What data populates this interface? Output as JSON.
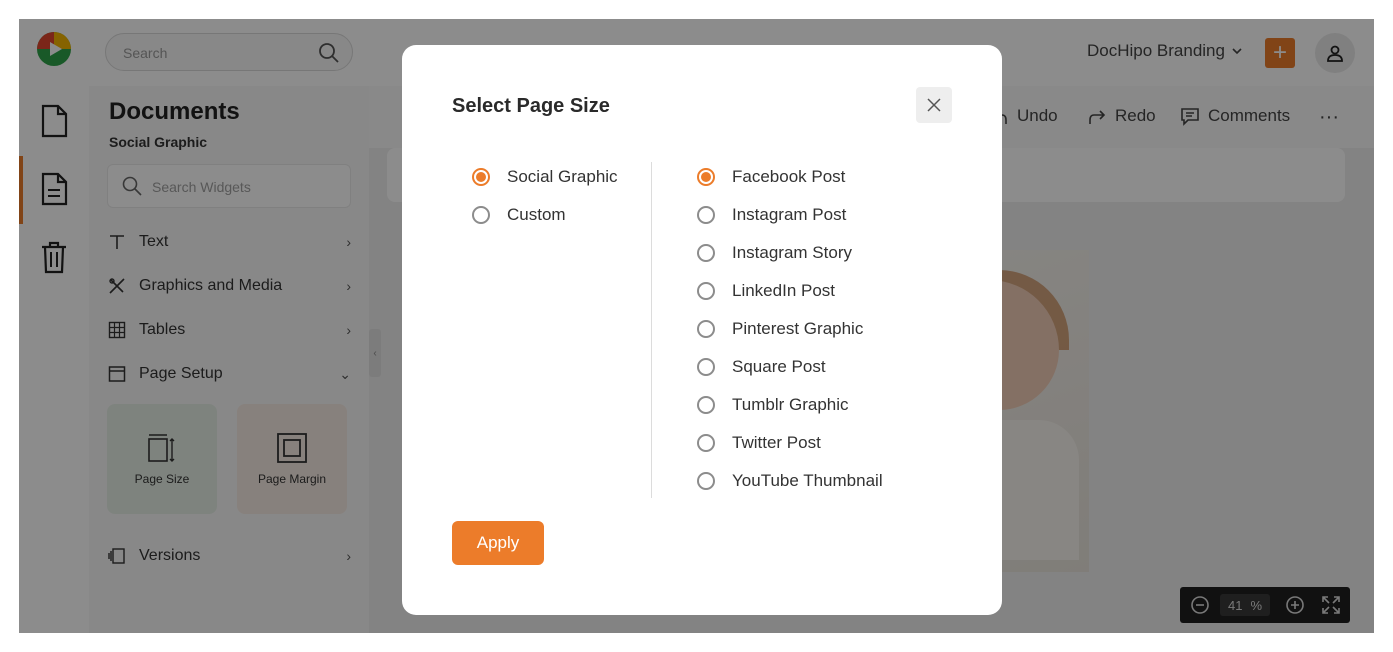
{
  "header": {
    "search_placeholder": "Search",
    "workspace_name": "DocHipo Branding",
    "create_label": "+"
  },
  "panel": {
    "title": "Documents",
    "subtitle": "Social Graphic",
    "search_placeholder": "Search Widgets",
    "items": [
      {
        "label": "Text"
      },
      {
        "label": "Graphics and Media"
      },
      {
        "label": "Tables"
      },
      {
        "label": "Page Setup"
      },
      {
        "label": "Versions"
      }
    ],
    "tiles": [
      {
        "label": "Page Size",
        "color": "#e6efe6"
      },
      {
        "label": "Page Margin",
        "color": "#f6ebe3"
      }
    ]
  },
  "toolbar": {
    "undo": "Undo",
    "redo": "Redo",
    "comments": "Comments",
    "more": "···"
  },
  "zoom": {
    "value": "41",
    "unit": "%"
  },
  "modal": {
    "title": "Select Page Size",
    "categories": [
      {
        "label": "Social Graphic",
        "selected": true
      },
      {
        "label": "Custom",
        "selected": false
      }
    ],
    "sizes": [
      {
        "label": "Facebook Post",
        "selected": true
      },
      {
        "label": "Instagram Post",
        "selected": false
      },
      {
        "label": "Instagram Story",
        "selected": false
      },
      {
        "label": "LinkedIn Post",
        "selected": false
      },
      {
        "label": "Pinterest Graphic",
        "selected": false
      },
      {
        "label": "Square Post",
        "selected": false
      },
      {
        "label": "Tumblr Graphic",
        "selected": false
      },
      {
        "label": "Twitter Post",
        "selected": false
      },
      {
        "label": "YouTube Thumbnail",
        "selected": false
      }
    ],
    "apply_label": "Apply"
  },
  "colors": {
    "accent": "#ec7c2a",
    "overlay": "rgba(0,0,0,0.45)"
  }
}
